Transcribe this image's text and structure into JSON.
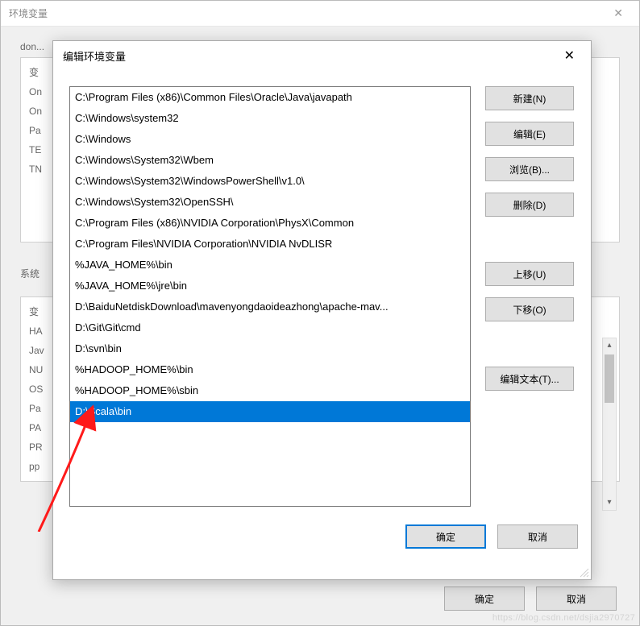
{
  "outer": {
    "title": "环境变量",
    "user_section_label": "don...",
    "user_vars_col": "变",
    "user_vars_rows": [
      "On",
      "On",
      "Pa",
      "TE",
      "TN"
    ],
    "sys_section_label": "系统",
    "sys_vars_col": "变",
    "sys_vars_rows": [
      "HA",
      "Jav",
      "NU",
      "OS",
      "Pa",
      "PA",
      "PR",
      "pp"
    ],
    "ok_label": "确定",
    "cancel_label": "取消"
  },
  "inner": {
    "title": "编辑环境变量",
    "close_glyph": "✕",
    "path_items": [
      "C:\\Program Files (x86)\\Common Files\\Oracle\\Java\\javapath",
      "C:\\Windows\\system32",
      "C:\\Windows",
      "C:\\Windows\\System32\\Wbem",
      "C:\\Windows\\System32\\WindowsPowerShell\\v1.0\\",
      "C:\\Windows\\System32\\OpenSSH\\",
      "C:\\Program Files (x86)\\NVIDIA Corporation\\PhysX\\Common",
      "C:\\Program Files\\NVIDIA Corporation\\NVIDIA NvDLISR",
      "%JAVA_HOME%\\bin",
      "%JAVA_HOME%\\jre\\bin",
      "D:\\BaiduNetdiskDownload\\mavenyongdaoideazhong\\apache-mav...",
      "D:\\Git\\Git\\cmd",
      "D:\\svn\\bin",
      "%HADOOP_HOME%\\bin",
      "%HADOOP_HOME%\\sbin",
      "D:\\Scala\\bin"
    ],
    "selected_index": 15,
    "buttons": {
      "new": "新建(N)",
      "edit": "编辑(E)",
      "browse": "浏览(B)...",
      "delete": "删除(D)",
      "moveup": "上移(U)",
      "movedown": "下移(O)",
      "edittext": "编辑文本(T)..."
    },
    "ok_label": "确定",
    "cancel_label": "取消"
  },
  "scroll": {
    "up": "▴",
    "down": "▾"
  },
  "watermark": "https://blog.csdn.net/dsjia2970727"
}
